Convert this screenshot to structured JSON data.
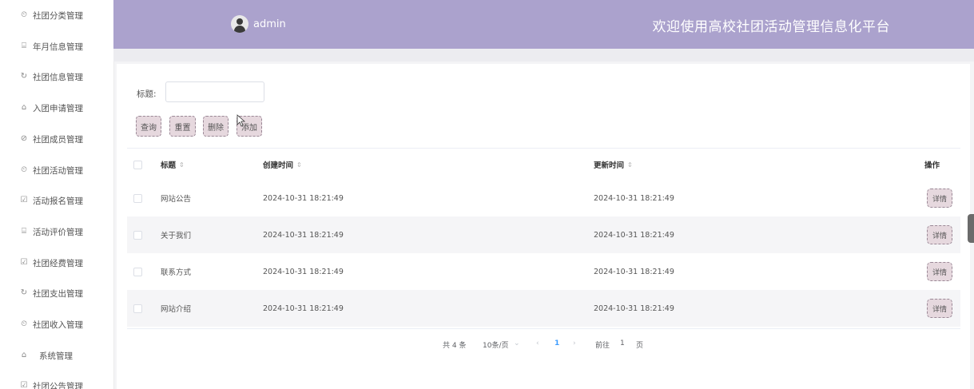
{
  "sidebar": {
    "items": [
      {
        "label": "社团分类管理",
        "icon": "clock-icon",
        "glyph": "⏲"
      },
      {
        "label": "年月信息管理",
        "icon": "gift-icon",
        "glyph": "⌸"
      },
      {
        "label": "社团信息管理",
        "icon": "refresh-icon",
        "glyph": "↻"
      },
      {
        "label": "入团申请管理",
        "icon": "home-icon",
        "glyph": "⌂"
      },
      {
        "label": "社团成员管理",
        "icon": "compass-icon",
        "glyph": "⊘"
      },
      {
        "label": "社团活动管理",
        "icon": "clock-icon",
        "glyph": "⏲"
      },
      {
        "label": "活动报名管理",
        "icon": "calendar-check-icon",
        "glyph": "☑"
      },
      {
        "label": "活动评价管理",
        "icon": "gift-icon",
        "glyph": "⌸"
      },
      {
        "label": "社团经费管理",
        "icon": "calendar-check-icon",
        "glyph": "☑"
      },
      {
        "label": "社团支出管理",
        "icon": "refresh-icon",
        "glyph": "↻"
      },
      {
        "label": "社团收入管理",
        "icon": "clock-icon",
        "glyph": "⏲"
      },
      {
        "label": "系统管理",
        "icon": "home-icon",
        "glyph": "⌂"
      },
      {
        "label": "社团公告管理",
        "icon": "calendar-check-icon",
        "glyph": "☑"
      }
    ]
  },
  "header": {
    "username": "admin",
    "welcome": "欢迎使用高校社团活动管理信息化平台",
    "bg_color": "#aba2cd"
  },
  "search": {
    "label": "标题:",
    "value": "",
    "placeholder": ""
  },
  "toolbar": {
    "query_label": "查询",
    "reset_label": "重置",
    "delete_label": "删除",
    "add_label": "添加"
  },
  "table": {
    "headers": {
      "title": "标题",
      "created": "创建时间",
      "updated": "更新时间",
      "actions": "操作"
    },
    "sort_glyph": "⇕",
    "detail_label": "详情",
    "rows": [
      {
        "title": "网站公告",
        "created": "2024-10-31 18:21:49",
        "updated": "2024-10-31 18:21:49"
      },
      {
        "title": "关于我们",
        "created": "2024-10-31 18:21:49",
        "updated": "2024-10-31 18:21:49"
      },
      {
        "title": "联系方式",
        "created": "2024-10-31 18:21:49",
        "updated": "2024-10-31 18:21:49"
      },
      {
        "title": "网站介绍",
        "created": "2024-10-31 18:21:49",
        "updated": "2024-10-31 18:21:49"
      }
    ]
  },
  "pagination": {
    "total": "共 4 条",
    "page_size": "10条/页",
    "dropdown_glyph": "⌄",
    "prev_glyph": "‹",
    "current_page": "1",
    "next_glyph": "›",
    "goto_label": "前往",
    "goto_value": "1",
    "page_suffix": "页"
  },
  "colors": {
    "button_bg": "#e6d8de",
    "accent": "#409eff"
  }
}
